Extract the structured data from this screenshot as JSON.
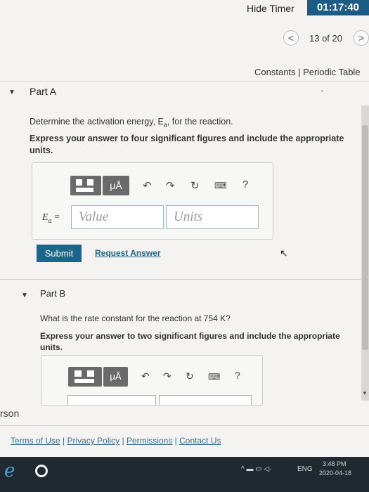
{
  "header": {
    "hide_timer_label": "Hide Timer",
    "timer_value": "01:17:40",
    "counter": "13 of 20",
    "prev": "<",
    "next": ">",
    "links": "Constants | Periodic Table"
  },
  "part_a": {
    "title": "Part A",
    "collapse_icon": "-",
    "question": "Determine the activation energy, E",
    "question_sub": "a",
    "question_end": ", for the reaction.",
    "instruction": "Express your answer to four significant figures and include the appropriate units.",
    "unit_button": "μÅ",
    "help_button": "?",
    "label": "E",
    "label_sub": "a",
    "label_eq": " =",
    "value_placeholder": "Value",
    "units_placeholder": "Units",
    "submit": "Submit",
    "request_answer": "Request Answer"
  },
  "part_b": {
    "title": "Part B",
    "question": "What is the rate constant for the reaction at 754 K?",
    "instruction": "Express your answer to two significant figures and include the appropriate units.",
    "unit_button": "μÅ",
    "help_button": "?"
  },
  "footer": {
    "rson": "rson",
    "links": [
      "Terms of Use",
      "Privacy Policy",
      "Permissions",
      "Contact Us"
    ]
  },
  "taskbar": {
    "time": "3:48 PM",
    "date": "2020-04-18",
    "lang": "ENG"
  }
}
